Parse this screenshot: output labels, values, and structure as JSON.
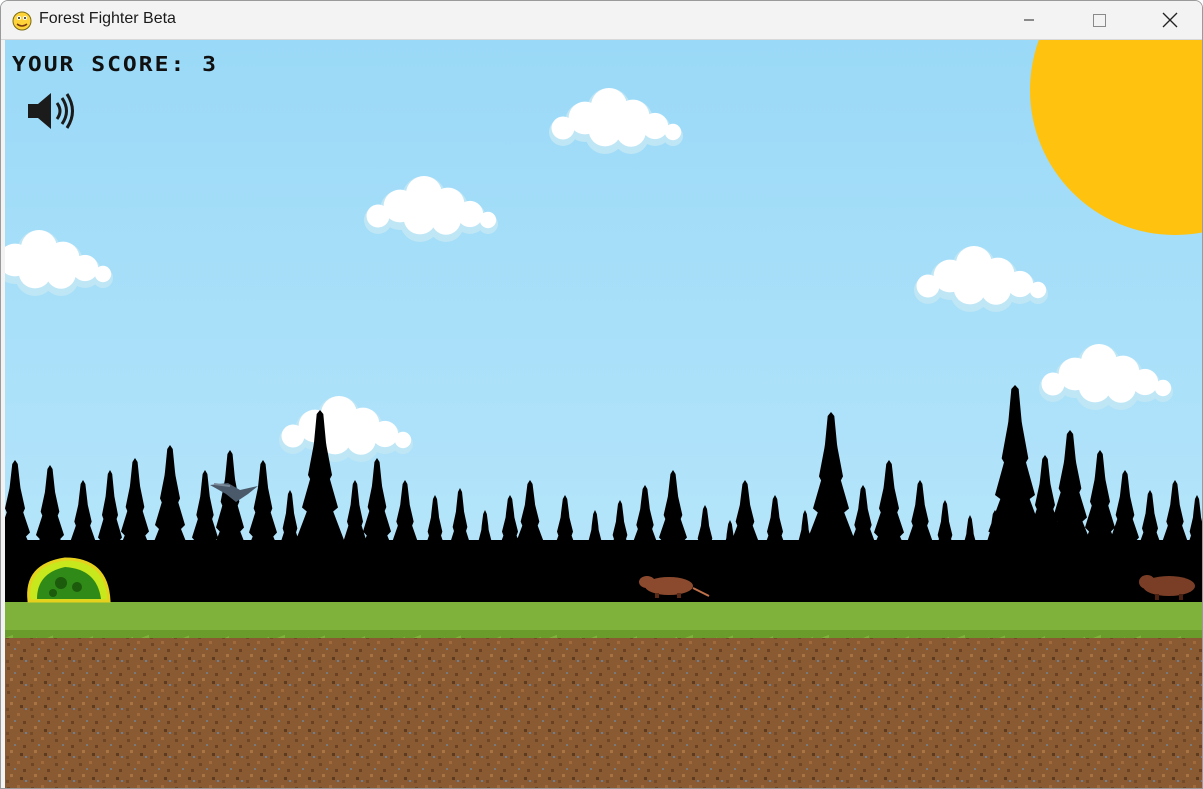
{
  "window": {
    "title": "Forest Fighter Beta",
    "app_icon": "pygame-snake-icon",
    "controls": {
      "minimize": "minimize-icon",
      "maximize": "maximize-icon",
      "close": "close-icon"
    }
  },
  "hud": {
    "score_label": "YOUR SCORE: 3",
    "sound_icon": "speaker-on-icon"
  },
  "colors": {
    "sky": "#9ad9f7",
    "sun": "#ffc20e",
    "trees": "#000000",
    "grass": "#7fb23a",
    "dirt": "#8a5a33",
    "slime": "#b6e31a",
    "rat": "#8b4a2e",
    "bird": "#4a5a6a"
  },
  "scene": {
    "clouds": 6,
    "enemies": [
      "bird-enemy",
      "rat-enemy",
      "rat-enemy"
    ],
    "player": "green-slime-player"
  }
}
